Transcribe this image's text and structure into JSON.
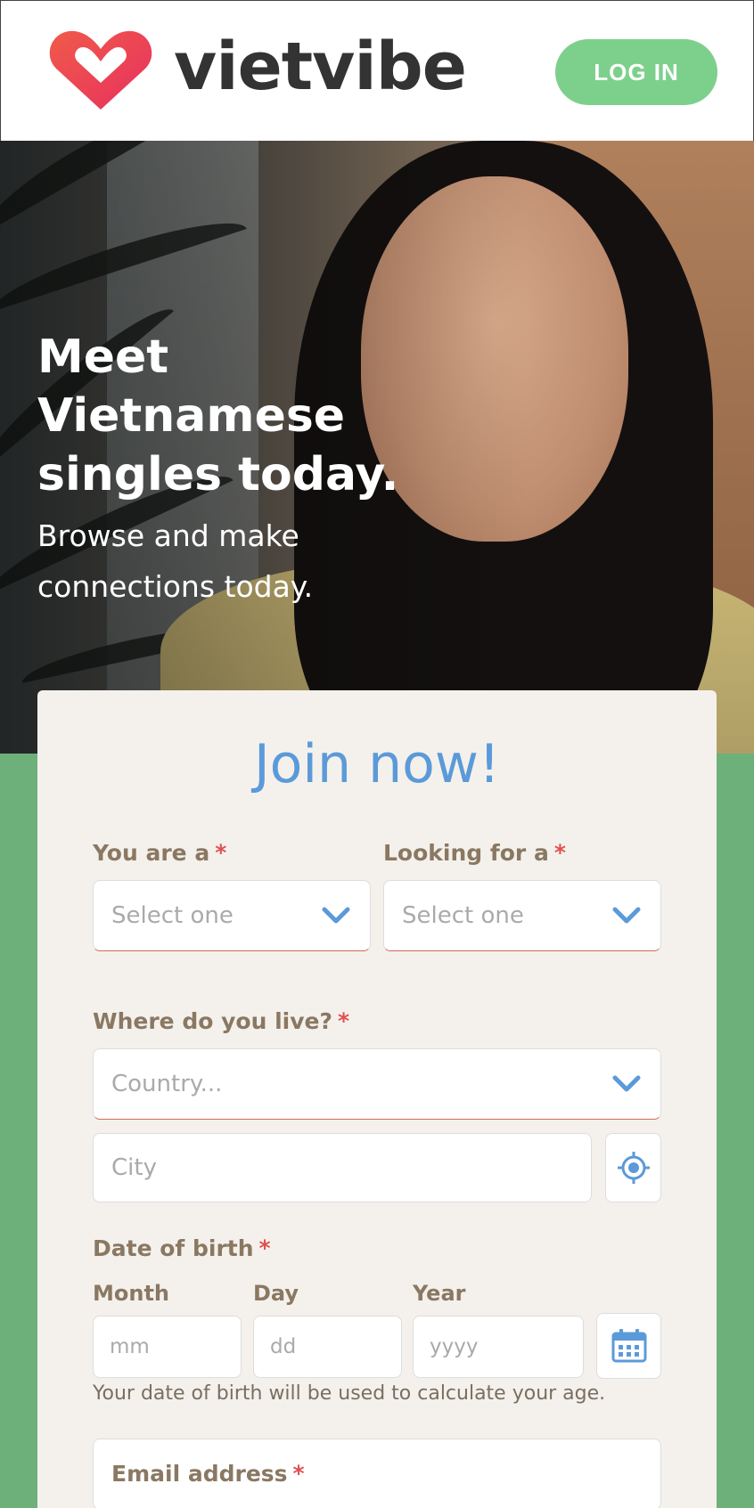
{
  "header": {
    "brand": "vietvibe",
    "login_label": "LOG IN"
  },
  "hero": {
    "title": "Meet Vietnamese singles today.",
    "subtitle": "Browse and make connections today."
  },
  "form": {
    "title": "Join now!",
    "you_are": {
      "label": "You are a",
      "required": "*",
      "placeholder": "Select one"
    },
    "looking_for": {
      "label": "Looking for a",
      "required": "*",
      "placeholder": "Select one"
    },
    "location": {
      "label": "Where do you live?",
      "required": "*",
      "country_placeholder": "Country...",
      "city_placeholder": "City"
    },
    "dob": {
      "label": "Date of birth",
      "required": "*",
      "month_label": "Month",
      "day_label": "Day",
      "year_label": "Year",
      "month_placeholder": "mm",
      "day_placeholder": "dd",
      "year_placeholder": "yyyy",
      "helper": "Your date of birth will be used to calculate your age."
    },
    "email": {
      "label": "Email address",
      "required": "*"
    }
  },
  "icons": {
    "logo": "heart-logo-icon",
    "select_arrow": "chevron-down-icon",
    "locate": "crosshair-locate-icon",
    "calendar": "calendar-icon"
  },
  "colors": {
    "brand_gradient_start": "#f04b5a",
    "brand_gradient_end": "#e8345f",
    "login_button": "#7dd08c",
    "title_blue": "#5b9ad9",
    "label_brown": "#8a7862",
    "required_red": "#e05050",
    "background_green": "#6db07a",
    "card_bg": "#f4f1ec"
  }
}
